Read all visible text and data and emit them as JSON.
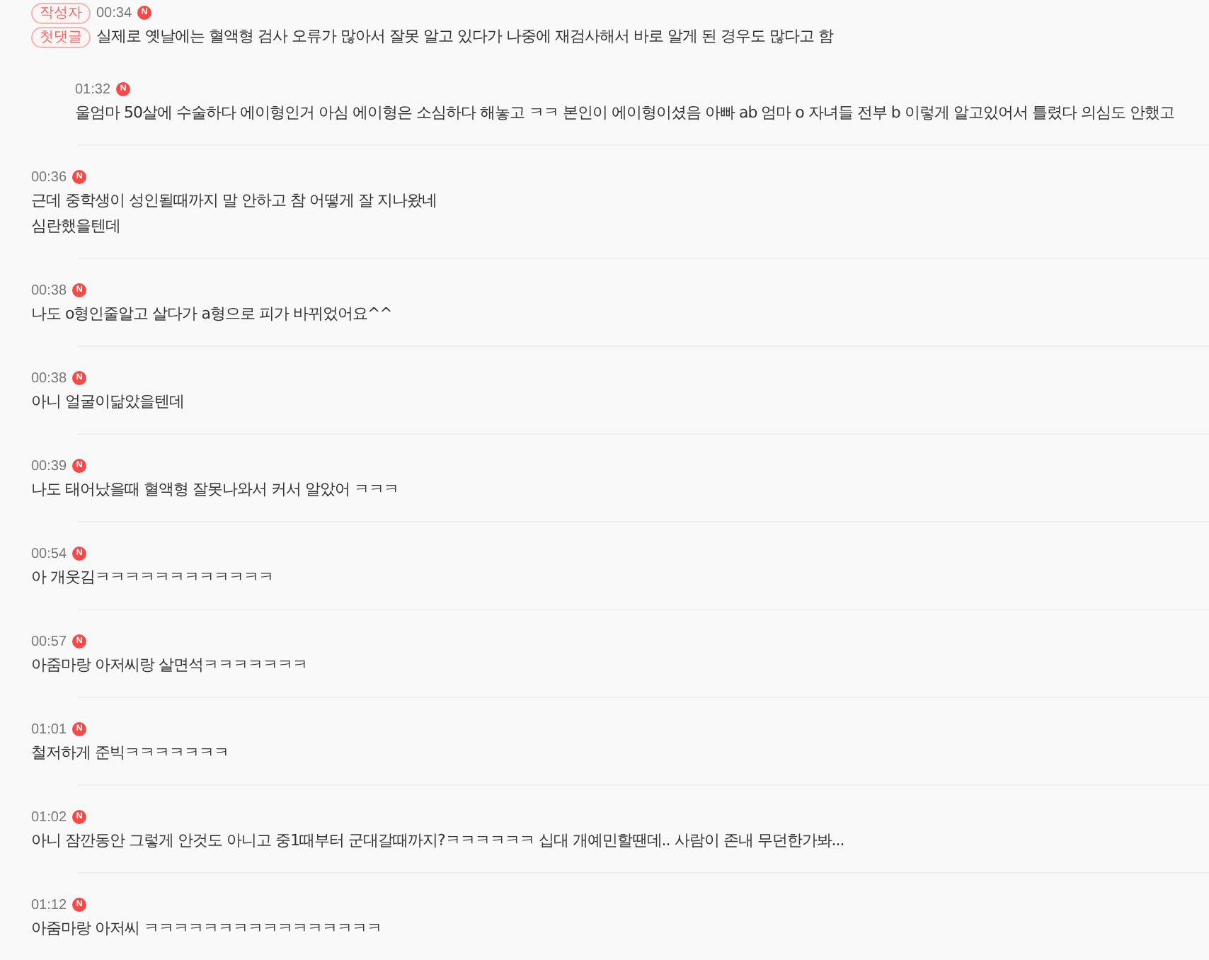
{
  "comments": [
    {
      "time": "00:34",
      "new_badge": "N",
      "author_badge": "작성자",
      "first_badge": "첫댓글",
      "text": "실제로 옛날에는 혈액형 검사 오류가 많아서 잘못 알고 있다가 나중에 재검사해서 바로 알게 된 경우도 많다고 함",
      "replies": [
        {
          "time": "01:32",
          "new_badge": "N",
          "text": "울엄마 50살에 수술하다 에이형인거 아심 에이형은 소심하다 해놓고 ㅋㅋ 본인이 에이형이셨음 아빠 ab 엄마 o 자녀들 전부 b 이렇게 알고있어서 틀렸다 의심도 안했고"
        }
      ]
    },
    {
      "time": "00:36",
      "new_badge": "N",
      "text": "근데 중학생이 성인될때까지 말 안하고 참 어떻게 잘 지나왔네\n심란했을텐데"
    },
    {
      "time": "00:38",
      "new_badge": "N",
      "text": "나도 o형인줄알고 살다가 a형으로 피가 바뀌었어요^^"
    },
    {
      "time": "00:38",
      "new_badge": "N",
      "text": "아니 얼굴이닮았을텐데"
    },
    {
      "time": "00:39",
      "new_badge": "N",
      "text": "나도 태어났을때 혈액형 잘못나와서 커서 알았어 ㅋㅋㅋ"
    },
    {
      "time": "00:54",
      "new_badge": "N",
      "text": "아 개웃김ㅋㅋㅋㅋㅋㅋㅋㅋㅋㅋㅋㅋ"
    },
    {
      "time": "00:57",
      "new_badge": "N",
      "text": "아줌마랑 아저씨랑 살면석ㅋㅋㅋㅋㅋㅋㅋ"
    },
    {
      "time": "01:01",
      "new_badge": "N",
      "text": "철저하게 준빅ㅋㅋㅋㅋㅋㅋㅋ"
    },
    {
      "time": "01:02",
      "new_badge": "N",
      "text": "아니 잠깐동안 그렇게 안것도 아니고 중1때부터 군대갈때까지?ㅋㅋㅋㅋㅋㅋ 십대 개예민할땐데.. 사람이 존내 무던한가봐..."
    },
    {
      "time": "01:12",
      "new_badge": "N",
      "text": "아줌마랑 아저씨 ㅋㅋㅋㅋㅋㅋㅋㅋㅋㅋㅋㅋㅋㅋㅋㅋ"
    }
  ]
}
